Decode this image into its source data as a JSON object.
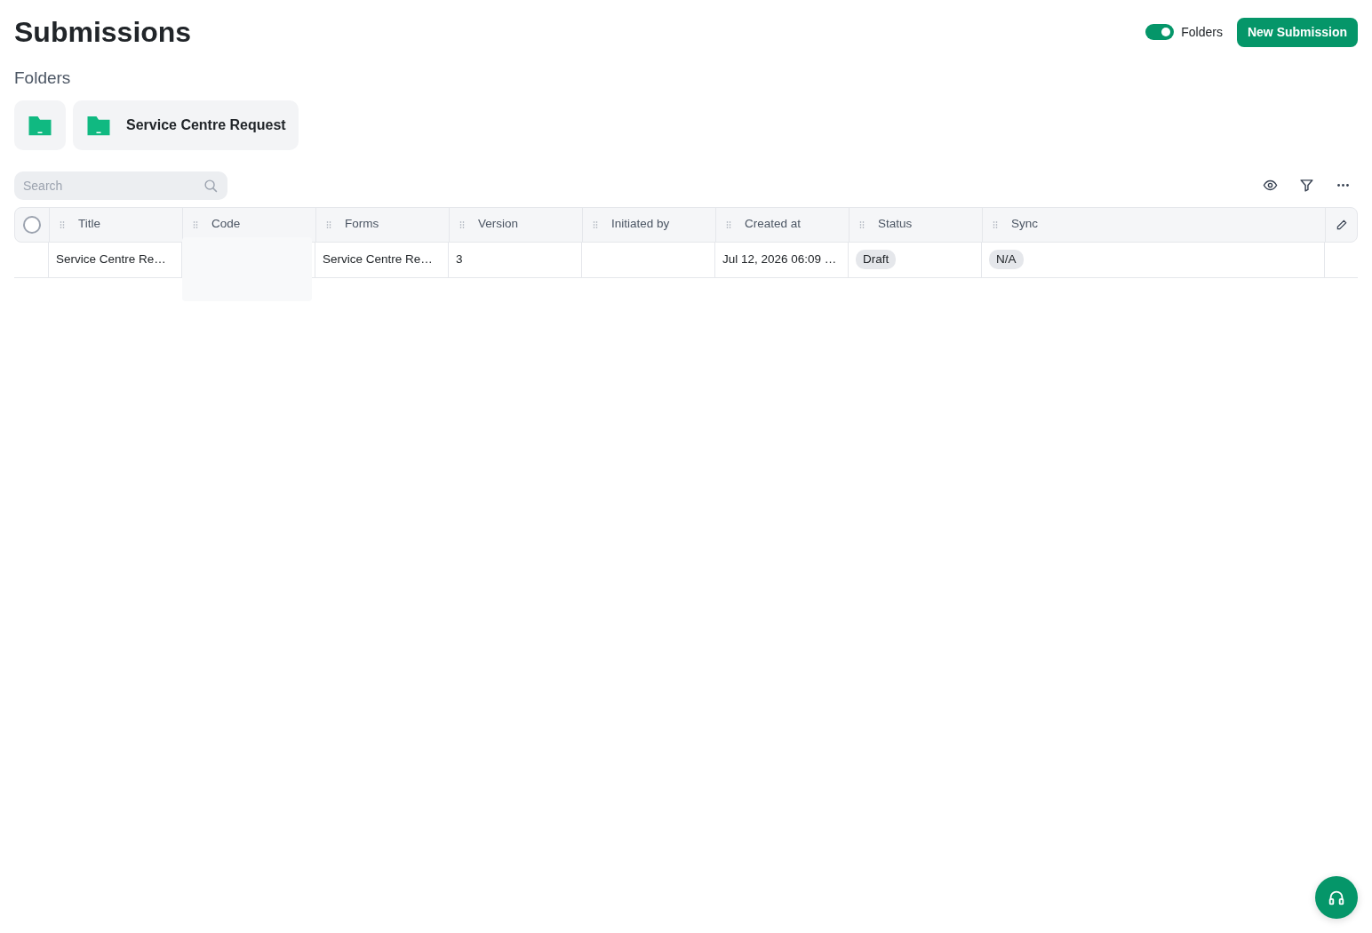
{
  "page": {
    "title": "Submissions"
  },
  "header_controls": {
    "toggle": {
      "label": "Folders",
      "on": true
    },
    "primary_button": "New Submission"
  },
  "folders": {
    "heading": "Folders",
    "items": [
      {
        "kind": "unnamed"
      },
      {
        "kind": "named",
        "label": "Service Centre Request"
      }
    ]
  },
  "search": {
    "placeholder": "Search"
  },
  "table": {
    "header_checkbox": {
      "checked": false
    },
    "columns": [
      "Title",
      "Code",
      "Forms",
      "Version",
      "Initiated by",
      "Created at",
      "Status",
      "Sync"
    ],
    "rows": [
      {
        "cells": [
          {
            "kind": "text",
            "text": "Service Centre Re…"
          },
          {
            "kind": "empty"
          },
          {
            "kind": "text",
            "text": "Service Centre Re…"
          },
          {
            "kind": "text",
            "text": "3"
          },
          {
            "kind": "empty"
          },
          {
            "kind": "text",
            "text": "Jul 12, 2026 06:09 …"
          },
          {
            "kind": "badge",
            "text": "Draft"
          },
          {
            "kind": "badge",
            "text": "N/A"
          }
        ]
      }
    ]
  },
  "overlay": {
    "kind": "blank-popover"
  }
}
